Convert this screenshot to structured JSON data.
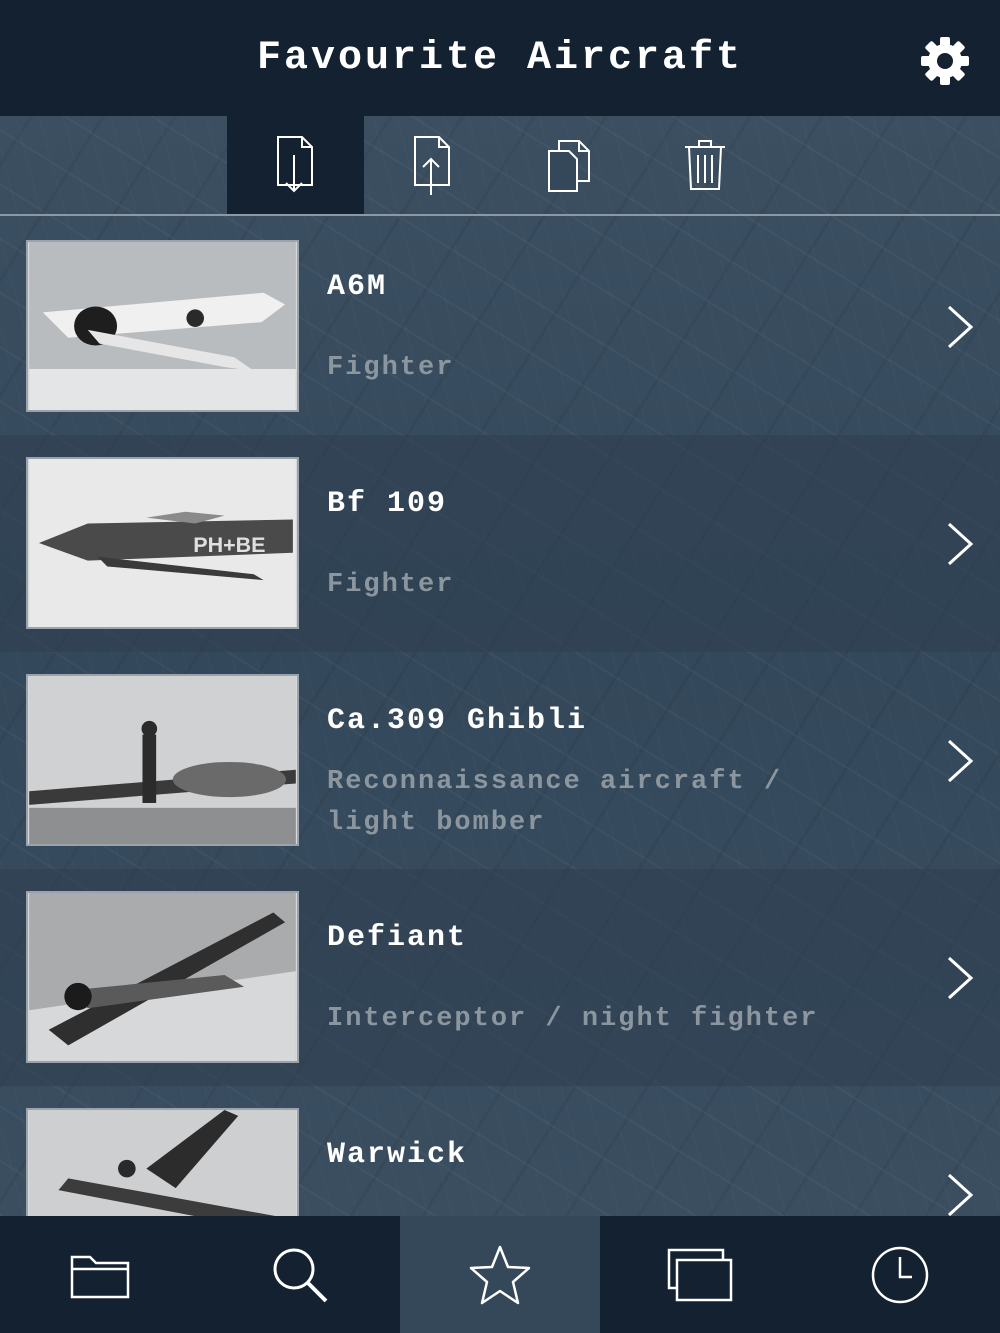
{
  "header": {
    "title": "Favourite Aircraft",
    "settings_icon": "gear-icon"
  },
  "toolbar": [
    {
      "icon": "import-icon",
      "active": true
    },
    {
      "icon": "export-icon",
      "active": false
    },
    {
      "icon": "copy-icon",
      "active": false
    },
    {
      "icon": "trash-icon",
      "active": false
    }
  ],
  "aircraft": [
    {
      "name": "A6M",
      "type": "Fighter"
    },
    {
      "name": "Bf 109",
      "type": "Fighter"
    },
    {
      "name": "Ca.309 Ghibli",
      "type": "Reconnaissance aircraft / light bomber"
    },
    {
      "name": "Defiant",
      "type": "Interceptor / night fighter"
    },
    {
      "name": "Warwick",
      "type": ""
    }
  ],
  "tabbar": [
    {
      "icon": "folder-icon",
      "active": false
    },
    {
      "icon": "search-icon",
      "active": false
    },
    {
      "icon": "star-icon",
      "active": true
    },
    {
      "icon": "windows-icon",
      "active": false
    },
    {
      "icon": "clock-icon",
      "active": false
    }
  ],
  "colors": {
    "bar": "#132130",
    "background": "#34485a",
    "subtitle": "#8c969f"
  }
}
